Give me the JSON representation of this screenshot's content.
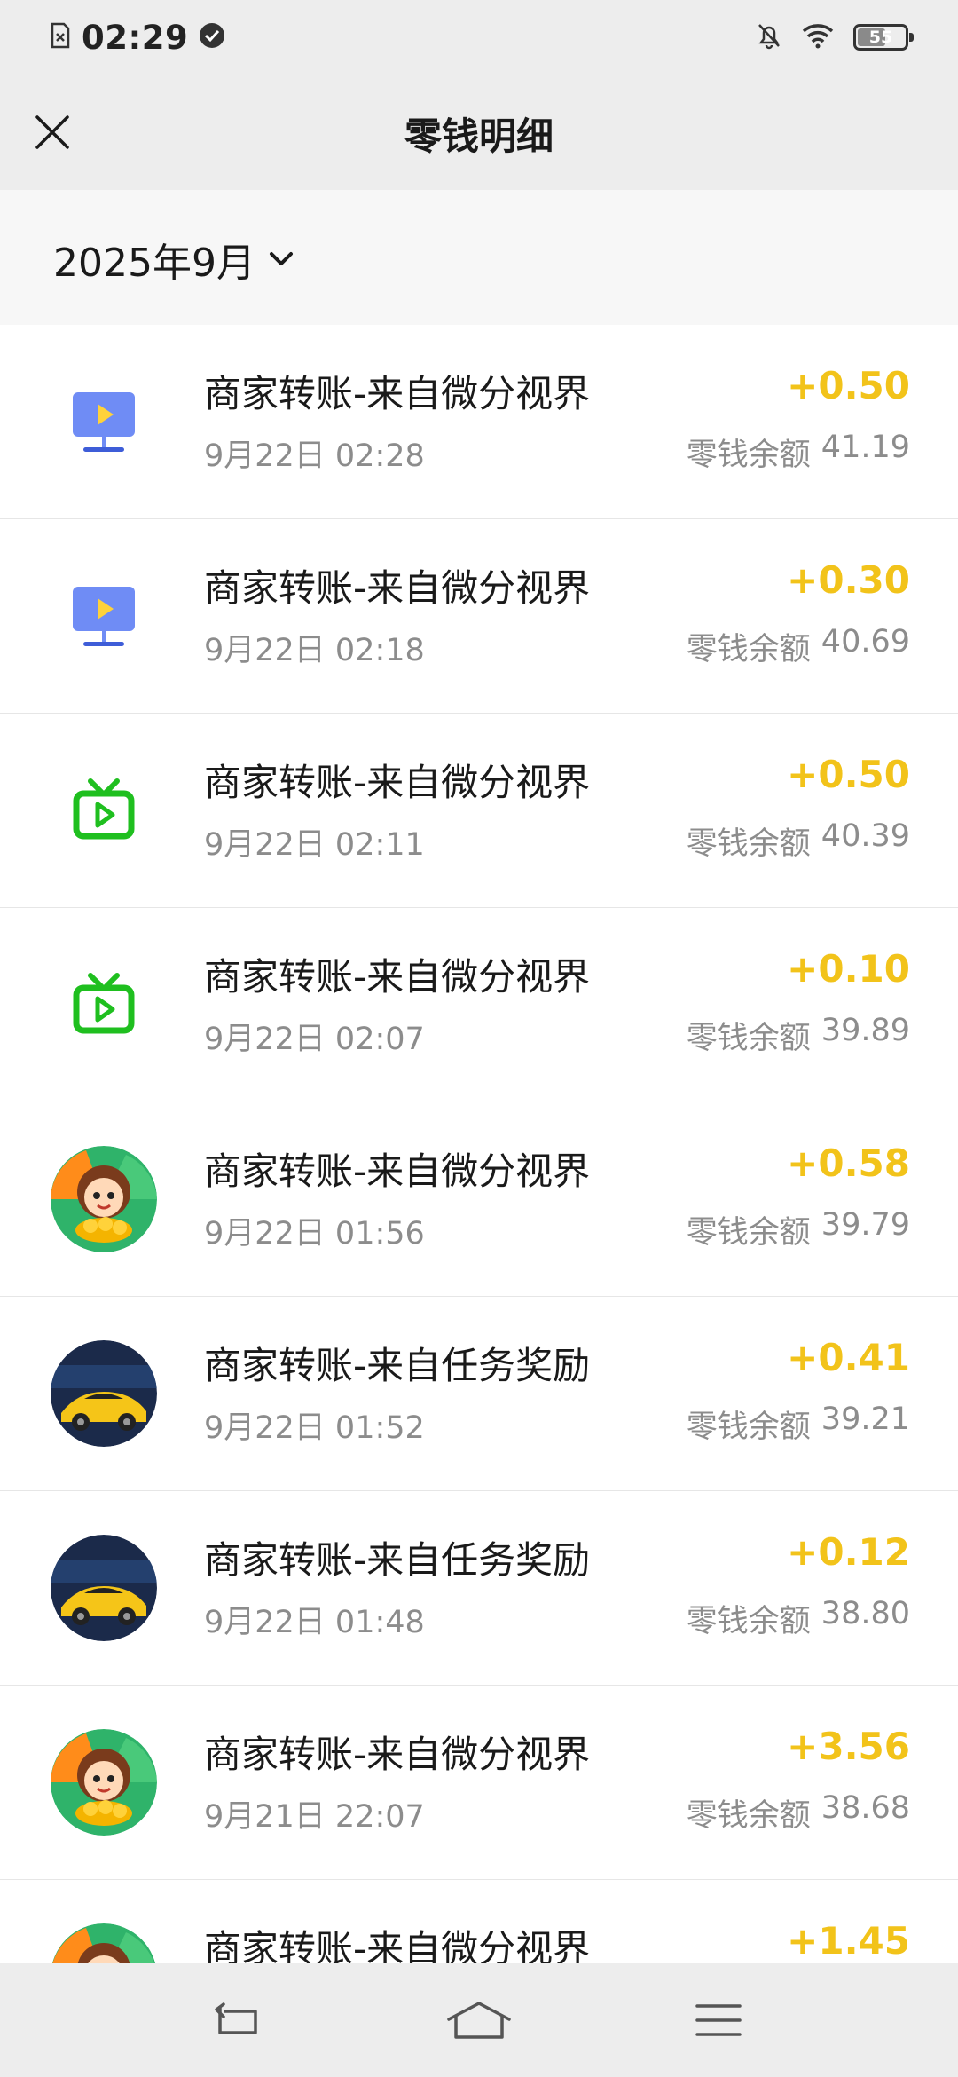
{
  "status_bar": {
    "time": "02:29",
    "battery": "55",
    "battery_level": 0.55,
    "icons": [
      "sim-icon",
      "check-circle-icon",
      "bell-off-icon",
      "wifi-icon",
      "battery-icon"
    ]
  },
  "header": {
    "title": "零钱明细",
    "close_icon": "close-icon"
  },
  "filter": {
    "month": "2025年9月",
    "dropdown_icon": "chevron-down-icon"
  },
  "colors": {
    "amount": "#f2c31a",
    "secondary_text": "#8c8c8c",
    "tv_green": "#1fbf1f",
    "monitor_blue": "#6f8cf5"
  },
  "transactions": [
    {
      "title": "商家转账-来自微分视界",
      "time": "9月22日 02:28",
      "amount": "+0.50",
      "balance_label": "零钱余额",
      "balance": "41.19",
      "avatar": "monitor-icon"
    },
    {
      "title": "商家转账-来自微分视界",
      "time": "9月22日 02:18",
      "amount": "+0.30",
      "balance_label": "零钱余额",
      "balance": "40.69",
      "avatar": "monitor-icon"
    },
    {
      "title": "商家转账-来自微分视界",
      "time": "9月22日 02:11",
      "amount": "+0.50",
      "balance_label": "零钱余额",
      "balance": "40.39",
      "avatar": "tv-icon"
    },
    {
      "title": "商家转账-来自微分视界",
      "time": "9月22日 02:07",
      "amount": "+0.10",
      "balance_label": "零钱余额",
      "balance": "39.89",
      "avatar": "tv-icon"
    },
    {
      "title": "商家转账-来自微分视界",
      "time": "9月22日 01:56",
      "amount": "+0.58",
      "balance_label": "零钱余额",
      "balance": "39.79",
      "avatar": "cartoon-girl-avatar"
    },
    {
      "title": "商家转账-来自任务奖励",
      "time": "9月22日 01:52",
      "amount": "+0.41",
      "balance_label": "零钱余额",
      "balance": "39.21",
      "avatar": "sports-car-avatar"
    },
    {
      "title": "商家转账-来自任务奖励",
      "time": "9月22日 01:48",
      "amount": "+0.12",
      "balance_label": "零钱余额",
      "balance": "38.80",
      "avatar": "sports-car-avatar"
    },
    {
      "title": "商家转账-来自微分视界",
      "time": "9月21日 22:07",
      "amount": "+3.56",
      "balance_label": "零钱余额",
      "balance": "38.68",
      "avatar": "cartoon-girl-avatar"
    },
    {
      "title": "商家转账-来自微分视界",
      "time": "",
      "amount": "+1.45",
      "balance_label": "",
      "balance": "",
      "avatar": "cartoon-girl-avatar"
    }
  ],
  "system_nav": {
    "buttons": [
      "back-icon",
      "home-icon",
      "menu-icon"
    ]
  }
}
